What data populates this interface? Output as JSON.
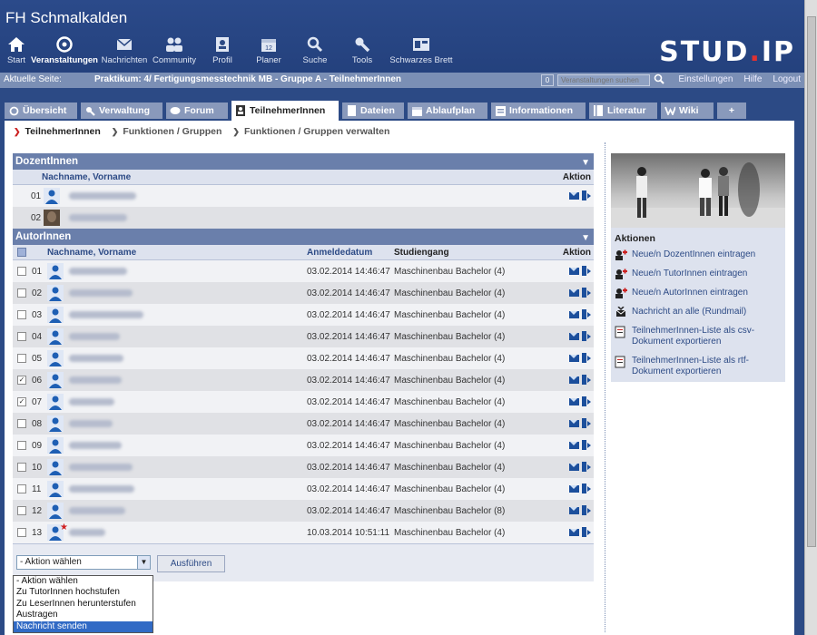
{
  "window": {
    "title": "FH Schmalkalden"
  },
  "nav": [
    {
      "label": "Start",
      "icon": "home-icon"
    },
    {
      "label": "Veranstaltungen",
      "icon": "courses-icon",
      "active": true
    },
    {
      "label": "Nachrichten",
      "icon": "mail-icon"
    },
    {
      "label": "Community",
      "icon": "community-icon"
    },
    {
      "label": "Profil",
      "icon": "profile-icon"
    },
    {
      "label": "Planer",
      "icon": "calendar-icon"
    },
    {
      "label": "Suche",
      "icon": "search-icon"
    },
    {
      "label": "Tools",
      "icon": "wrench-icon"
    },
    {
      "label": "Schwarzes Brett",
      "icon": "board-icon"
    }
  ],
  "logo": {
    "left": "STUD",
    "dot": ".",
    "right": "IP"
  },
  "breadcrumb": {
    "label": "Aktuelle Seite:",
    "title": "Praktikum: 4/ Fertigungsmesstechnik MB - Gruppe A - TeilnehmerInnen"
  },
  "quicksearch": {
    "placeholder": "Veranstaltungen suchen",
    "box": "0"
  },
  "toplinks": {
    "settings": "Einstellungen",
    "help": "Hilfe",
    "logout": "Logout"
  },
  "tabs": [
    "Übersicht",
    "Verwaltung",
    "Forum",
    "TeilnehmerInnen",
    "Dateien",
    "Ablaufplan",
    "Informationen",
    "Literatur",
    "Wiki",
    "+"
  ],
  "subnav": [
    "TeilnehmerInnen",
    "Funktionen / Gruppen",
    "Funktionen / Gruppen verwalten"
  ],
  "dozenten": {
    "heading": "DozentInnen",
    "col_name": "Nachname, Vorname",
    "col_action": "Aktion",
    "rows": [
      {
        "num": "01"
      },
      {
        "num": "02"
      }
    ]
  },
  "autoren": {
    "heading": "AutorInnen",
    "col_name": "Nachname, Vorname",
    "col_date": "Anmeldedatum",
    "col_study": "Studiengang",
    "col_action": "Aktion",
    "rows": [
      {
        "num": "01",
        "date": "03.02.2014 14:46:47",
        "study": "Maschinenbau Bachelor (4)",
        "checked": false
      },
      {
        "num": "02",
        "date": "03.02.2014 14:46:47",
        "study": "Maschinenbau Bachelor (4)",
        "checked": false
      },
      {
        "num": "03",
        "date": "03.02.2014 14:46:47",
        "study": "Maschinenbau Bachelor (4)",
        "checked": false
      },
      {
        "num": "04",
        "date": "03.02.2014 14:46:47",
        "study": "Maschinenbau Bachelor (4)",
        "checked": false
      },
      {
        "num": "05",
        "date": "03.02.2014 14:46:47",
        "study": "Maschinenbau Bachelor (4)",
        "checked": false
      },
      {
        "num": "06",
        "date": "03.02.2014 14:46:47",
        "study": "Maschinenbau Bachelor (4)",
        "checked": true
      },
      {
        "num": "07",
        "date": "03.02.2014 14:46:47",
        "study": "Maschinenbau Bachelor (4)",
        "checked": true
      },
      {
        "num": "08",
        "date": "03.02.2014 14:46:47",
        "study": "Maschinenbau Bachelor (4)",
        "checked": false
      },
      {
        "num": "09",
        "date": "03.02.2014 14:46:47",
        "study": "Maschinenbau Bachelor (4)",
        "checked": false
      },
      {
        "num": "10",
        "date": "03.02.2014 14:46:47",
        "study": "Maschinenbau Bachelor (4)",
        "checked": false
      },
      {
        "num": "11",
        "date": "03.02.2014 14:46:47",
        "study": "Maschinenbau Bachelor (4)",
        "checked": false
      },
      {
        "num": "12",
        "date": "03.02.2014 14:46:47",
        "study": "Maschinenbau Bachelor (8)",
        "checked": false
      },
      {
        "num": "13",
        "date": "10.03.2014 10:51:11",
        "study": "Maschinenbau Bachelor (4)",
        "checked": false
      }
    ]
  },
  "bulk": {
    "selected": "- Aktion wählen",
    "button": "Ausführen",
    "options": [
      "- Aktion wählen",
      "Zu TutorInnen hochstufen",
      "Zu LeserInnen herunterstufen",
      "Austragen",
      "Nachricht senden"
    ]
  },
  "sidebar": {
    "heading": "Aktionen",
    "actions": [
      "Neue/n DozentInnen eintragen",
      "Neue/n TutorInnen eintragen",
      "Neue/n AutorInnen eintragen",
      "Nachricht an alle (Rundmail)",
      "TeilnehmerInnen-Liste als csv-Dokument exportieren",
      "TeilnehmerInnen-Liste als rtf-Dokument exportieren"
    ]
  },
  "colors": {
    "brand": "#2c4a85",
    "accent_red": "#e03131",
    "highlight": "#316ac5"
  }
}
